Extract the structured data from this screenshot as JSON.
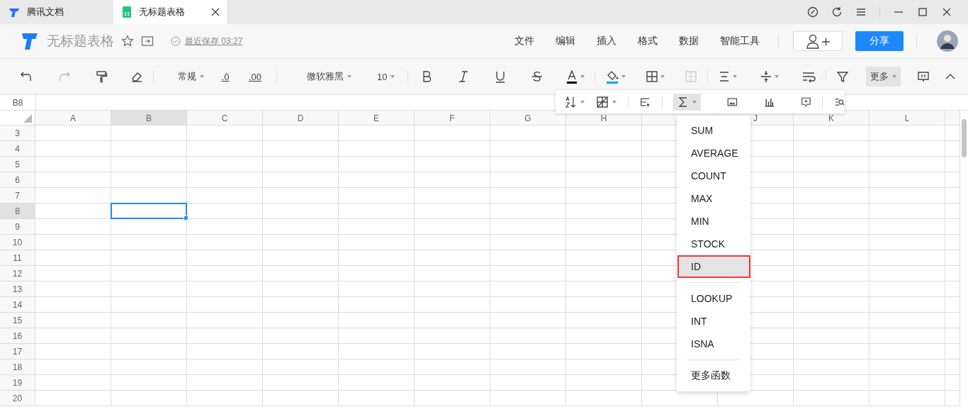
{
  "browser_tabs": [
    {
      "label": "腾讯文档",
      "selected": false
    },
    {
      "label": "无标题表格",
      "selected": true
    }
  ],
  "header": {
    "title": "无标题表格",
    "save_status": "最近保存 03:27",
    "menu": [
      "文件",
      "编辑",
      "插入",
      "格式",
      "数据",
      "智能工具"
    ],
    "share_button": "分享"
  },
  "toolbar": {
    "number_format": "常规",
    "decimal_decrease": ".0",
    "decimal_increase": ".00",
    "font": "微软雅黑",
    "font_size": "10",
    "more_button": "更多"
  },
  "formula_bar": {
    "cell_ref": "B8"
  },
  "sheet": {
    "columns": [
      {
        "label": "A",
        "selected": false
      },
      {
        "label": "B",
        "selected": true
      },
      {
        "label": "C",
        "selected": false
      },
      {
        "label": "D",
        "selected": false
      },
      {
        "label": "E",
        "selected": false
      },
      {
        "label": "F",
        "selected": false
      },
      {
        "label": "G",
        "selected": false
      },
      {
        "label": "H",
        "selected": false
      },
      {
        "selected": false
      },
      {
        "label": "J",
        "selected": false
      },
      {
        "label": "K",
        "selected": false
      },
      {
        "label": "L",
        "selected": false
      },
      {
        "selected": false
      }
    ],
    "rows": [
      {
        "label": "3",
        "selected": false
      },
      {
        "label": "4",
        "selected": false
      },
      {
        "label": "5",
        "selected": false
      },
      {
        "label": "6",
        "selected": false
      },
      {
        "label": "7",
        "selected": false
      },
      {
        "label": "8",
        "selected": true
      },
      {
        "label": "9",
        "selected": false
      },
      {
        "label": "10",
        "selected": false
      },
      {
        "label": "11",
        "selected": false
      },
      {
        "label": "12",
        "selected": false
      },
      {
        "label": "13",
        "selected": false
      },
      {
        "label": "14",
        "selected": false
      },
      {
        "label": "15",
        "selected": false
      },
      {
        "label": "16",
        "selected": false
      },
      {
        "label": "17",
        "selected": false
      },
      {
        "label": "18",
        "selected": false
      },
      {
        "label": "19",
        "selected": false
      },
      {
        "label": "20",
        "selected": false
      }
    ]
  },
  "function_menu": {
    "groups": [
      [
        {
          "label": "SUM",
          "selected": false
        },
        {
          "label": "AVERAGE",
          "selected": false
        },
        {
          "label": "COUNT",
          "selected": false
        },
        {
          "label": "MAX",
          "selected": false
        },
        {
          "label": "MIN",
          "selected": false
        },
        {
          "label": "STOCK",
          "selected": false
        },
        {
          "label": "ID",
          "selected": true
        }
      ],
      [
        {
          "label": "LOOKUP",
          "selected": false
        },
        {
          "label": "INT",
          "selected": false
        },
        {
          "label": "ISNA",
          "selected": false
        }
      ]
    ],
    "more_functions": "更多函数"
  }
}
